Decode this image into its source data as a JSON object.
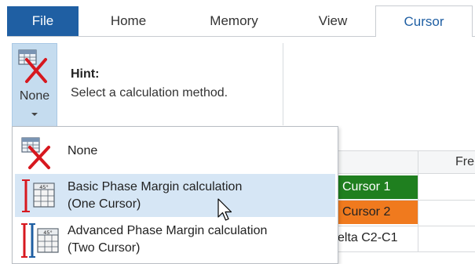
{
  "tabs": {
    "file": "File",
    "home": "Home",
    "memory": "Memory",
    "view": "View",
    "cursor": "Cursor"
  },
  "ribbon": {
    "method_button_label": "None",
    "hint_title": "Hint:",
    "hint_text": "Select a calculation method."
  },
  "menu": {
    "items": [
      {
        "label_line1": "None",
        "label_line2": "",
        "icon": "none-calc-icon"
      },
      {
        "label_line1": "Basic Phase Margin calculation",
        "label_line2": "(One Cursor)",
        "icon": "one-cursor-phase-icon"
      },
      {
        "label_line1": "Advanced Phase Margin calculation",
        "label_line2": "(Two Cursor)",
        "icon": "two-cursor-phase-icon"
      }
    ],
    "hovered_index": 1
  },
  "table": {
    "header_partial": "Fre",
    "rows": [
      {
        "label": "Cursor 1",
        "color": "#1f7f1f"
      },
      {
        "label": "Cursor 2",
        "color": "#f07a1e"
      },
      {
        "label": "elta C2-C1",
        "color": "#ffffff"
      }
    ]
  },
  "colors": {
    "file_tab": "#1f5fa3",
    "active_tab_text": "#1f5fa3",
    "pressed_button": "#c5dcef",
    "menu_hover": "#d6e6f5"
  }
}
